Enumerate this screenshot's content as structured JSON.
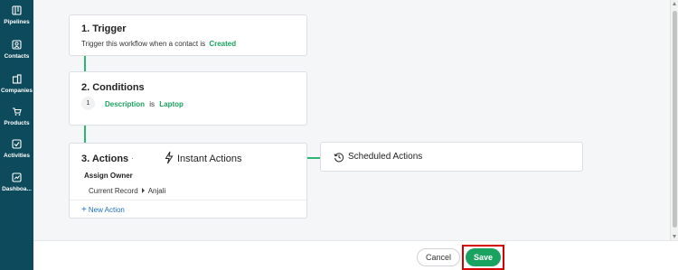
{
  "sidebar": {
    "items": [
      {
        "label": "Pipelines"
      },
      {
        "label": "Contacts"
      },
      {
        "label": "Companies"
      },
      {
        "label": "Products"
      },
      {
        "label": "Activities"
      },
      {
        "label": "Dashboa..."
      }
    ]
  },
  "trigger": {
    "title": "1. Trigger",
    "text": "Trigger this workflow when a contact is",
    "value": "Created"
  },
  "conditions": {
    "title": "2. Conditions",
    "row": {
      "index": "1",
      "field": "Description",
      "operator": "is",
      "value": "Laptop"
    }
  },
  "actions": {
    "title": "3. Actions",
    "separator": "·",
    "instant_label": "Instant Actions",
    "action_name": "Assign Owner",
    "detail_left": "Current Record",
    "detail_right": "Anjali",
    "new_action": "New Action",
    "new_action_plus": "+"
  },
  "scheduled": {
    "label": "Scheduled Actions"
  },
  "footer": {
    "cancel": "Cancel",
    "save": "Save"
  },
  "colors": {
    "sidebar": "#0d4a5c",
    "accent": "#1aa260",
    "highlight": "#d60000"
  }
}
